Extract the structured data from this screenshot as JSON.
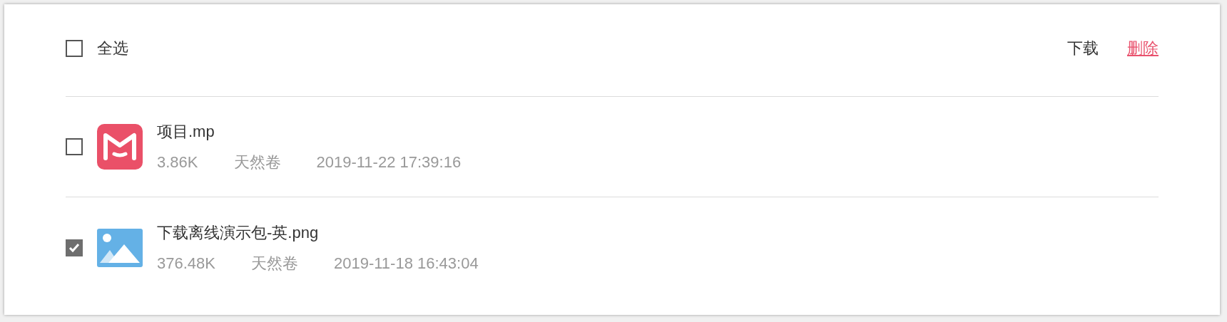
{
  "toolbar": {
    "select_all": {
      "label": "全选",
      "checked": false
    },
    "actions": [
      {
        "label": "下载",
        "kind": "plain"
      },
      {
        "label": "删除",
        "kind": "danger"
      }
    ]
  },
  "files": [
    {
      "name": "项目.mp",
      "kind": "mp",
      "size": "3.86K",
      "owner": "天然卷",
      "time": "2019-11-22 17:39:16",
      "checked": false
    },
    {
      "name": "下载离线演示包-英.png",
      "kind": "image",
      "size": "376.48K",
      "owner": "天然卷",
      "time": "2019-11-18 16:43:04",
      "checked": true
    }
  ]
}
